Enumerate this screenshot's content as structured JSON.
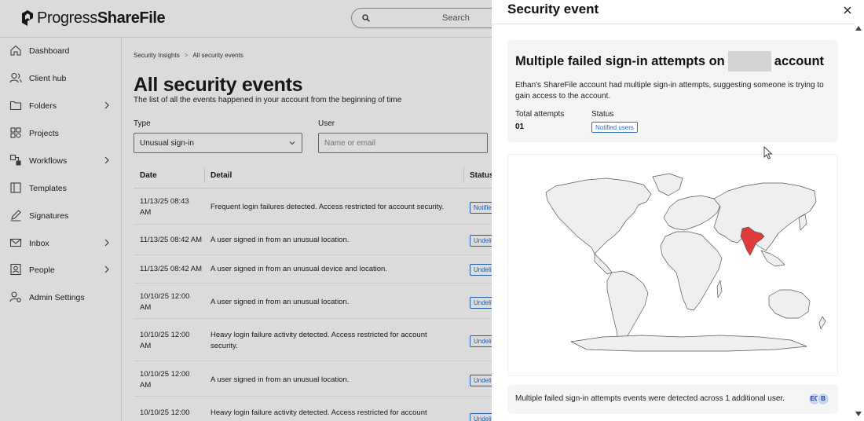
{
  "brand": {
    "name_light": "Progress",
    "name_bold": "ShareFile"
  },
  "search": {
    "placeholder": "Search"
  },
  "sidebar": {
    "items": [
      {
        "label": "Dashboard",
        "icon": "home-icon"
      },
      {
        "label": "Client hub",
        "icon": "people-icon"
      },
      {
        "label": "Folders",
        "icon": "folder-icon",
        "expand": true
      },
      {
        "label": "Projects",
        "icon": "grid-icon"
      },
      {
        "label": "Workflows",
        "icon": "workflow-icon",
        "expand": true
      },
      {
        "label": "Templates",
        "icon": "template-icon"
      },
      {
        "label": "Signatures",
        "icon": "pen-icon"
      },
      {
        "label": "Inbox",
        "icon": "mail-icon",
        "expand": true
      },
      {
        "label": "People",
        "icon": "person-icon",
        "expand": true
      },
      {
        "label": "Admin Settings",
        "icon": "gear-icon"
      }
    ]
  },
  "main": {
    "breadcrumb": {
      "parent": "Security Insights",
      "sep": ">",
      "current": "All security events"
    },
    "title": "All security events",
    "subtitle": "The list of all the events happened in your account from the beginning of time",
    "filters": {
      "type_label": "Type",
      "type_value": "Unusual sign-in",
      "user_label": "User",
      "user_placeholder": "Name or email"
    },
    "table": {
      "headers": {
        "date": "Date",
        "detail": "Detail",
        "status": "Status"
      },
      "rows": [
        {
          "date": "11/13/25 08:43 AM",
          "detail": "Frequent login failures detected. Access restricted for account security.",
          "status": "Notified users"
        },
        {
          "date": "11/13/25 08:42 AM",
          "detail": "A user signed in from an unusual location.",
          "status": "Undelivered"
        },
        {
          "date": "11/13/25 08:42 AM",
          "detail": "A user signed in from an unusual device and location.",
          "status": "Undelivered"
        },
        {
          "date": "10/10/25 12:00 AM",
          "detail": "A user signed in from an unusual location.",
          "status": "Undelivered"
        },
        {
          "date": "10/10/25 12:00 AM",
          "detail": "Heavy login failure activity detected. Access restricted for account security.",
          "status": "Undelivered"
        },
        {
          "date": "10/10/25 12:00 AM",
          "detail": "A user signed in from an unusual location.",
          "status": "Undelivered"
        },
        {
          "date": "10/10/25 12:00",
          "detail": "Heavy login failure activity detected. Access restricted for account",
          "status": "Undelivered"
        }
      ]
    }
  },
  "panel": {
    "title": "Security event",
    "card": {
      "title_prefix": "Multiple failed sign-in attempts on",
      "title_suffix": "account",
      "description": "Ethan's ShareFile account had multiple sign-in attempts, suggesting someone is trying to gain access to the account.",
      "total_label": "Total attempts",
      "total_value": "01",
      "status_label": "Status",
      "status_value": "Notified users"
    },
    "map": {
      "highlight_country": "India",
      "highlight_color": "#e03c3c",
      "land_color": "#efefef",
      "outline_color": "#555555"
    },
    "footer": {
      "text": "Multiple failed sign-in attempts events were detected across 1 additional user.",
      "avatars": [
        "EC",
        "B"
      ]
    }
  },
  "colors": {
    "accent": "#2b6cc4",
    "overlay": "rgba(0,0,0,0.14)"
  }
}
